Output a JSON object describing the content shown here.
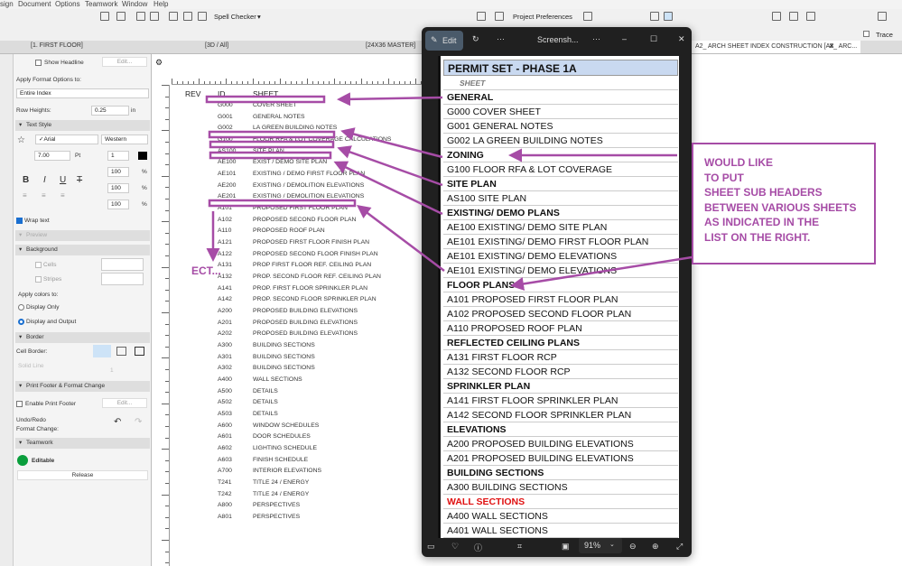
{
  "menubar": {
    "items": [
      "sign",
      "Document",
      "Options",
      "Teamwork",
      "Window",
      "Help"
    ]
  },
  "toolbar": {
    "spell_checker": "Spell Checker",
    "project_preferences": "Project Preferences",
    "trace": "Trace"
  },
  "tabs": [
    "[1. FIRST FLOOR]",
    "[3D / All]",
    "[24X36 MASTER]",
    "A2_ ARCH SHEET INDEX CONSTRUCTION [A2_ ARC..."
  ],
  "panel": {
    "show_headline": "Show Headline",
    "edit": "Edit...",
    "apply_format_label": "Apply Format Options to:",
    "apply_format_value": "Entire Index",
    "row_heights_label": "Row Heights:",
    "row_heights_value": "0.25",
    "row_heights_unit": "in",
    "text_style": "Text Style",
    "font": "✓Arial",
    "script": "Western",
    "font_size": "7.00",
    "font_unit": "Pt",
    "pen": "1",
    "scale1": "100",
    "scale2": "100",
    "scale3": "100",
    "percent": "%",
    "wrap_text": "Wrap text",
    "wrap_checked": true,
    "preview": "Preview",
    "background": "Background",
    "cells": "Cells",
    "stripes": "Stripes",
    "apply_colors": "Apply colors to:",
    "display_only": "Display Only",
    "display_output": "Display and Output",
    "border": "Border",
    "cell_border": "Cell Border:",
    "solid_line": "Solid Line",
    "border_pen": "1",
    "footer_section": "Print Footer & Format Change",
    "enable_footer": "Enable Print Footer",
    "undo_redo": "Undo/Redo",
    "format_change": "Format Change:",
    "teamwork": "Teamwork",
    "editable": "Editable",
    "release": "Release",
    "status_color": "#0a9e3c"
  },
  "sheet_index": {
    "headers": {
      "rev": "REV",
      "id": "ID",
      "sheet": "SHEET"
    },
    "rows": [
      [
        "G000",
        "COVER SHEET"
      ],
      [
        "G001",
        "GENERAL NOTES"
      ],
      [
        "G002",
        "LA GREEN BUILDING NOTES"
      ],
      [
        "G100",
        "FLOOR RFA & LOT COVERAGE CALCULATIONS"
      ],
      [
        "AS100",
        "SITE PLAN"
      ],
      [
        "AE100",
        "EXIST / DEMO SITE PLAN"
      ],
      [
        "AE101",
        "EXISTING / DEMO FIRST FLOOR PLAN"
      ],
      [
        "AE200",
        "EXISTING / DEMOLITION ELEVATIONS"
      ],
      [
        "AE201",
        "EXISTING / DEMOLITION  ELEVATIONS"
      ],
      [
        "A101",
        "PROPOSED FIRST FLOOR PLAN"
      ],
      [
        "A102",
        "PROPOSED SECOND FLOOR PLAN"
      ],
      [
        "A110",
        "PROPOSED ROOF PLAN"
      ],
      [
        "A121",
        "PROPOSED FIRST FLOOR FINISH PLAN"
      ],
      [
        "A122",
        "PROPOSED SECOND FLOOR FINISH PLAN"
      ],
      [
        "A131",
        "PROP FIRST FLOOR REF. CEILING PLAN"
      ],
      [
        "A132",
        "PROP. SECOND FLOOR REF. CEILING PLAN"
      ],
      [
        "A141",
        "PROP. FIRST FLOOR SPRINKLER PLAN"
      ],
      [
        "A142",
        "PROP. SECOND FLOOR SPRINKLER PLAN"
      ],
      [
        "A200",
        "PROPOSED BUILDING ELEVATIONS"
      ],
      [
        "A201",
        "PROPOSED BUILDING ELEVATIONS"
      ],
      [
        "A202",
        "PROPOSED BUILDING ELEVATIONS"
      ],
      [
        "A300",
        "BUILDING SECTIONS"
      ],
      [
        "A301",
        "BUILDING SECTIONS"
      ],
      [
        "A302",
        "BUILDING SECTIONS"
      ],
      [
        "A400",
        "WALL SECTIONS"
      ],
      [
        "A500",
        "DETAILS"
      ],
      [
        "A502",
        "DETAILS"
      ],
      [
        "A503",
        "DETAILS"
      ],
      [
        "A600",
        "WINDOW SCHEDULES"
      ],
      [
        "A601",
        "DOOR SCHEDULES"
      ],
      [
        "A602",
        "LIGHTING SCHEDULE"
      ],
      [
        "A603",
        "FINISH SCHEDULE"
      ],
      [
        "A700",
        "INTERIOR ELEVATIONS"
      ],
      [
        "T241",
        "TITLE 24 / ENERGY"
      ],
      [
        "T242",
        "TITLE 24 / ENERGY"
      ],
      [
        "A800",
        "PERSPECTIVES"
      ],
      [
        "A801",
        "PERSPECTIVES"
      ]
    ]
  },
  "annotation": {
    "etc": "ECT...",
    "color": "#a64ca6",
    "callout_lines": [
      "WOULD LIKE",
      "TO PUT",
      "SHEET SUB HEADERS",
      "BETWEEN VARIOUS SHEETS",
      "AS INDICATED IN THE",
      "LIST ON THE RIGHT."
    ]
  },
  "viewer": {
    "edit": "Edit",
    "title": "Screensh...",
    "zoom": "91%",
    "permit_title": "PERMIT SET - PHASE 1A",
    "sheet_header": "SHEET",
    "header_color": "#c9d9f0",
    "rows": [
      {
        "t": "GENERAL",
        "k": "b"
      },
      {
        "t": "G000 COVER SHEET"
      },
      {
        "t": "G001 GENERAL NOTES"
      },
      {
        "t": "G002 LA GREEN BUILDING NOTES"
      },
      {
        "t": "ZONING",
        "k": "b"
      },
      {
        "t": "G100 FLOOR RFA & LOT COVERAGE"
      },
      {
        "t": "SITE PLAN",
        "k": "b"
      },
      {
        "t": "AS100 SITE PLAN"
      },
      {
        "t": "EXISTING/ DEMO PLANS",
        "k": "b"
      },
      {
        "t": "AE100 EXISTING/ DEMO SITE PLAN"
      },
      {
        "t": "AE101 EXISTING/ DEMO FIRST FLOOR PLAN"
      },
      {
        "t": "AE101 EXISTING/ DEMO ELEVATIONS"
      },
      {
        "t": "AE101 EXISTING/ DEMO ELEVATIONS"
      },
      {
        "t": "FLOOR PLANS",
        "k": "b"
      },
      {
        "t": "A101 PROPOSED FIRST FLOOR PLAN"
      },
      {
        "t": "A102 PROPOSED SECOND FLOOR PLAN"
      },
      {
        "t": "A110 PROPOSED ROOF PLAN"
      },
      {
        "t": "REFLECTED CEILING PLANS",
        "k": "b"
      },
      {
        "t": "A131 FIRST FLOOR RCP"
      },
      {
        "t": "A132 SECOND FLOOR RCP"
      },
      {
        "t": "SPRINKLER PLAN",
        "k": "b"
      },
      {
        "t": "A141 FIRST FLOOR SPRINKLER PLAN"
      },
      {
        "t": "A142 SECOND FLOOR SPRINKLER PLAN"
      },
      {
        "t": "ELEVATIONS",
        "k": "b"
      },
      {
        "t": "A200 PROPOSED BUILDING ELEVATIONS"
      },
      {
        "t": "A201 PROPOSED BUILDING ELEVATIONS"
      },
      {
        "t": "BUILDING SECTIONS",
        "k": "b"
      },
      {
        "t": "A300 BUILDING SECTIONS"
      },
      {
        "t": "WALL SECTIONS",
        "k": "red"
      },
      {
        "t": "A400 WALL SECTIONS"
      },
      {
        "t": "A401 WALL SECTIONS"
      }
    ]
  }
}
